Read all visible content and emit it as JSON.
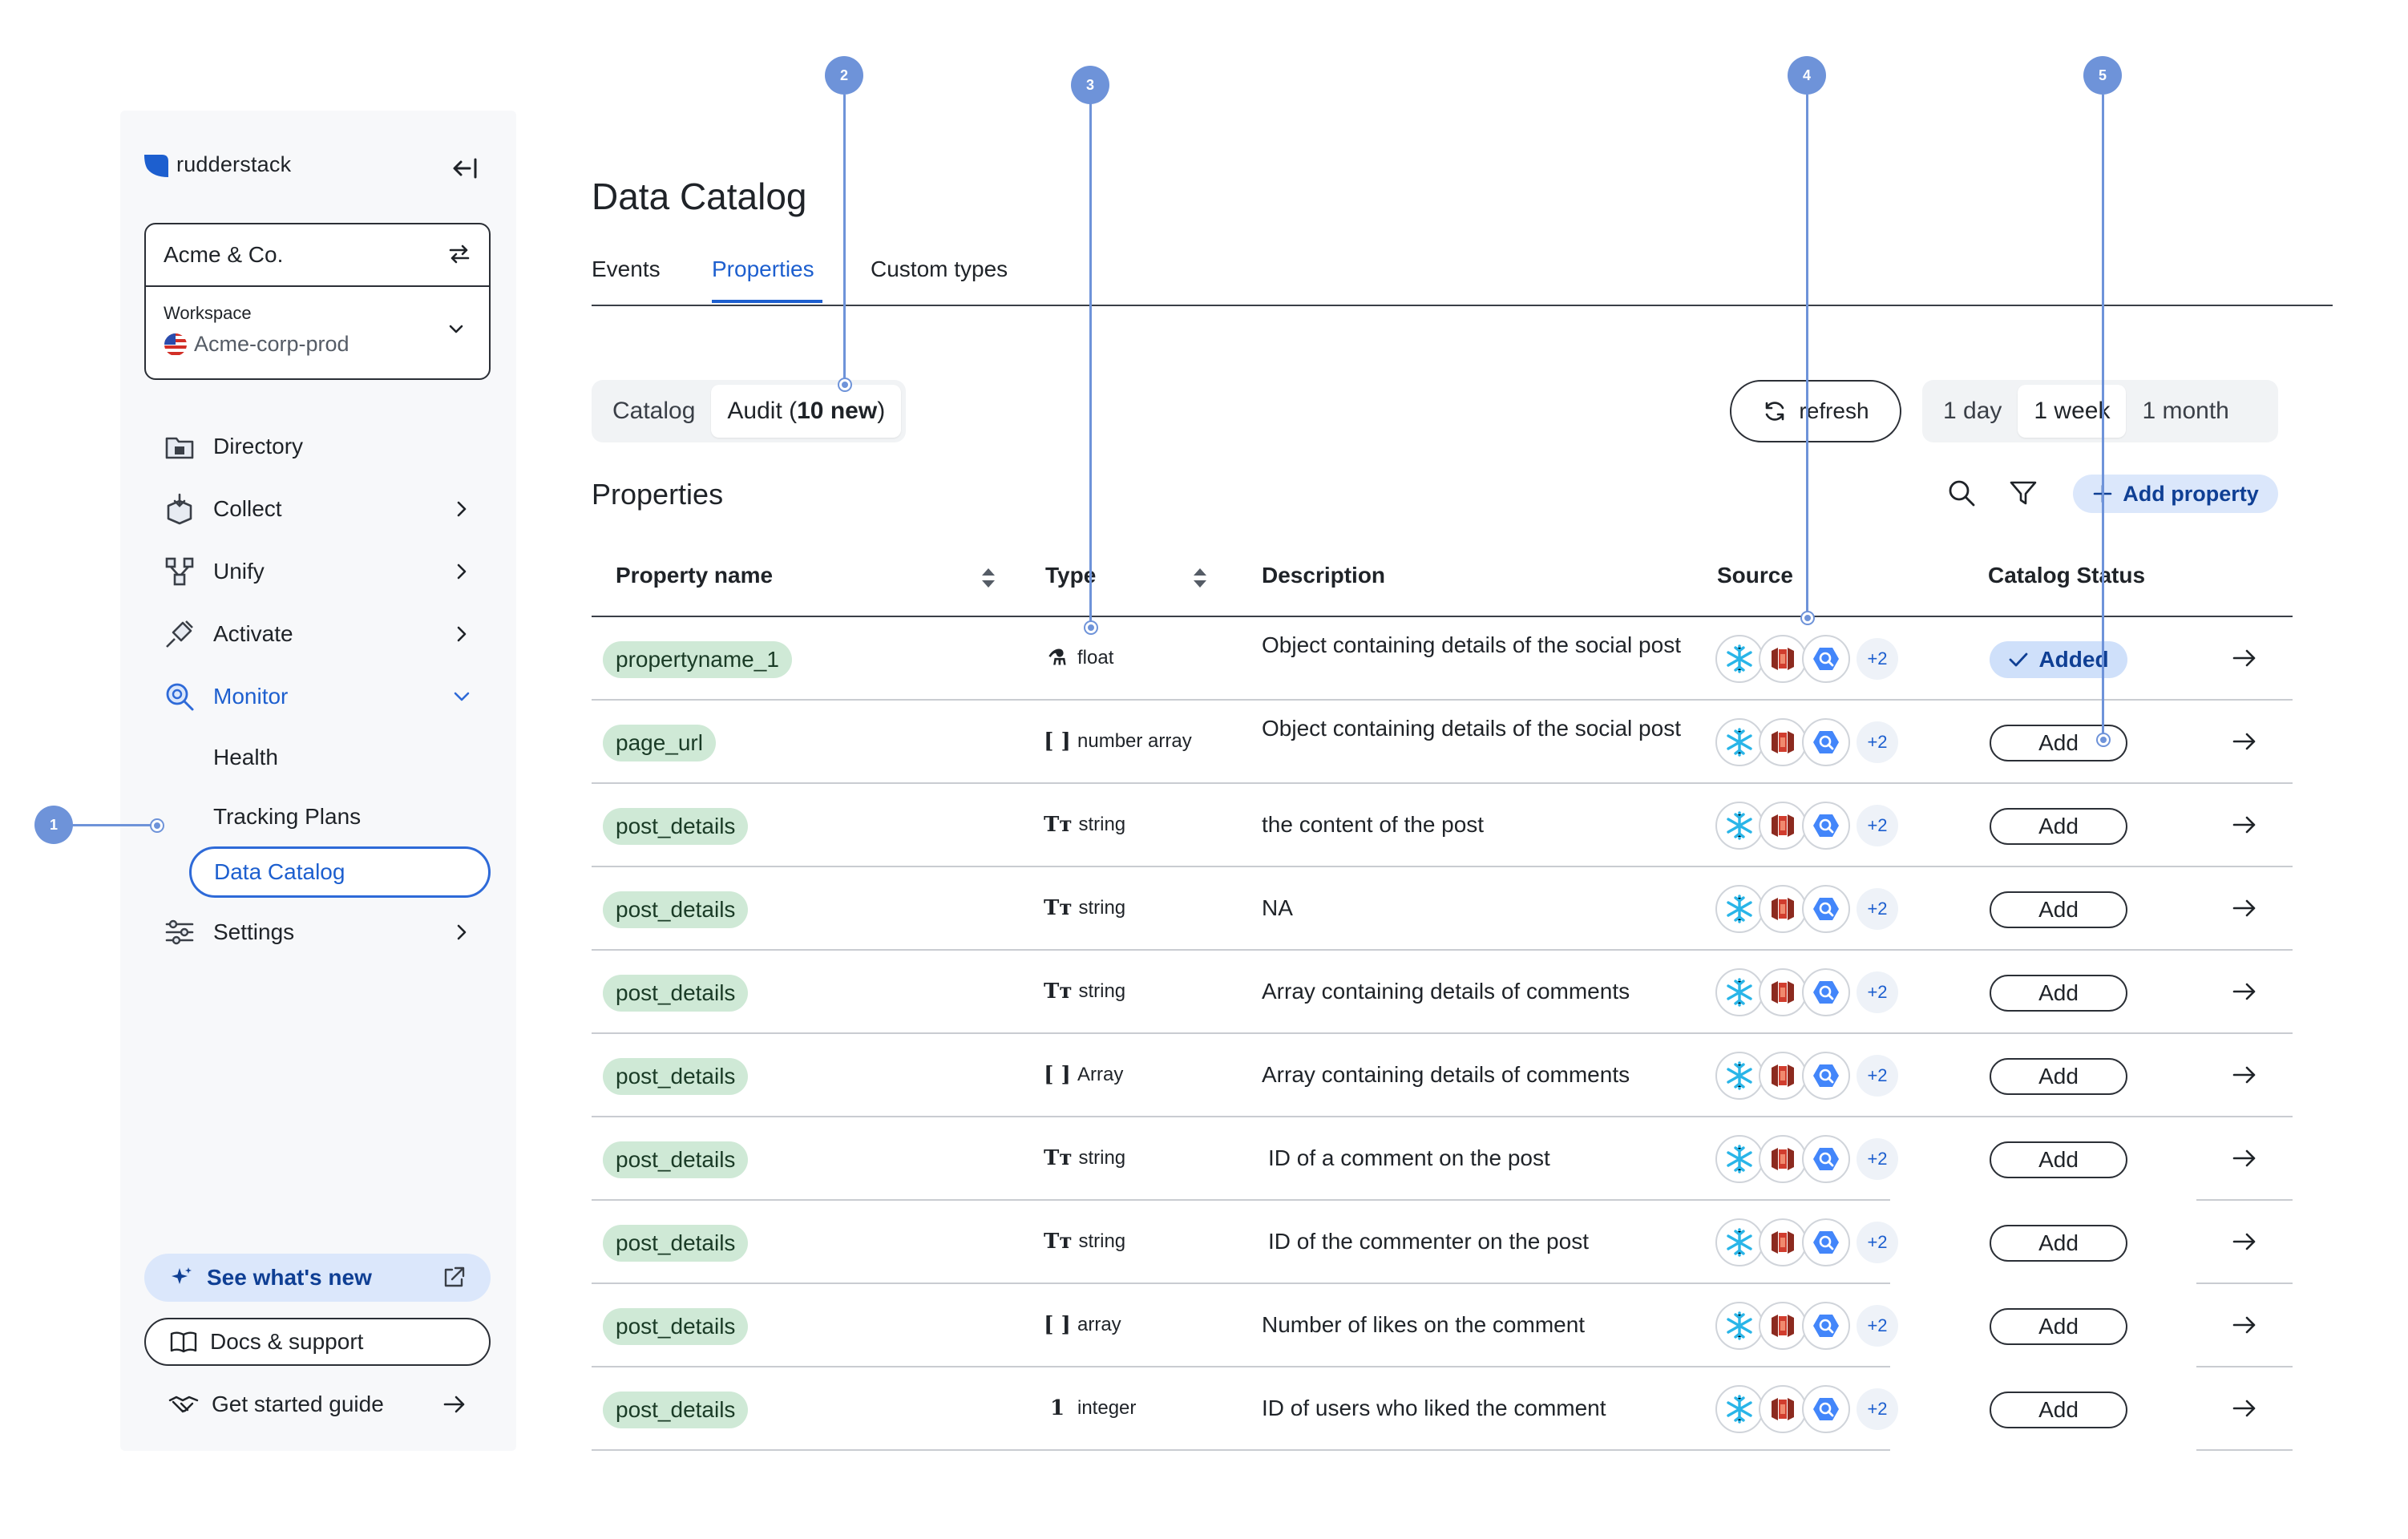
{
  "sidebar": {
    "logo_text": "rudderstack",
    "workspace": {
      "org": "Acme & Co.",
      "label": "Workspace",
      "name": "Acme-corp-prod"
    },
    "nav": [
      {
        "label": "Directory",
        "icon": "directory-icon"
      },
      {
        "label": "Collect",
        "icon": "collect-icon"
      },
      {
        "label": "Unify",
        "icon": "unify-icon"
      },
      {
        "label": "Activate",
        "icon": "activate-icon"
      },
      {
        "label": "Monitor",
        "icon": "monitor-icon"
      }
    ],
    "monitor_sub": [
      "Health",
      "Tracking Plans",
      "Data Catalog"
    ],
    "settings_label": "Settings",
    "bottom": {
      "whats_new": "See what's new",
      "docs": "Docs & support",
      "guide": "Get started guide"
    }
  },
  "main": {
    "title": "Data Catalog",
    "tabs": [
      "Events",
      "Properties",
      "Custom types"
    ],
    "active_tab": "Properties",
    "view_toggle": {
      "catalog": "Catalog",
      "audit_prefix": "Audit (",
      "audit_count": "10 new",
      "audit_suffix": ")"
    },
    "refresh_label": "refresh",
    "time_range": [
      "1 day",
      "1 week",
      "1 month"
    ],
    "selected_range": "1 week",
    "section_title": "Properties",
    "add_property_label": "Add property",
    "columns": [
      "Property name",
      "Type",
      "Description",
      "Source",
      "Catalog Status"
    ],
    "rows": [
      {
        "name": "propertyname_1",
        "type_glyph": "⚗",
        "type": "float",
        "description": "Object containing details of the social post",
        "more_sources": "+2",
        "status": "Added"
      },
      {
        "name": "page_url",
        "type_glyph": "[ ]",
        "type": "number array",
        "description": "Object containing details of the social post",
        "more_sources": "+2",
        "status": "Add"
      },
      {
        "name": "post_details",
        "type_glyph": "Tт",
        "type": "string",
        "description": "the content of the post",
        "more_sources": "+2",
        "status": "Add"
      },
      {
        "name": "post_details",
        "type_glyph": "Tт",
        "type": "string",
        "description": "NA",
        "more_sources": "+2",
        "status": "Add"
      },
      {
        "name": "post_details",
        "type_glyph": "Tт",
        "type": "string",
        "description": "Array containing details of comments",
        "more_sources": "+2",
        "status": "Add"
      },
      {
        "name": "post_details",
        "type_glyph": "[ ]",
        "type": "Array",
        "description": "Array containing details of comments",
        "more_sources": "+2",
        "status": "Add"
      },
      {
        "name": "post_details",
        "type_glyph": "Tт",
        "type": "string",
        "description": " ID of a comment on the post",
        "more_sources": "+2",
        "status": "Add"
      },
      {
        "name": "post_details",
        "type_glyph": "Tт",
        "type": "string",
        "description": " ID of the commenter on the post",
        "more_sources": "+2",
        "status": "Add"
      },
      {
        "name": "post_details",
        "type_glyph": "[ ]",
        "type": "array",
        "description": "Number of likes on the comment",
        "more_sources": "+2",
        "status": "Add"
      },
      {
        "name": "post_details",
        "type_glyph": "1",
        "type": "integer",
        "description": "ID of users who liked the comment",
        "more_sources": "+2",
        "status": "Add"
      }
    ]
  },
  "annotations": [
    "1",
    "2",
    "3",
    "4",
    "5"
  ],
  "colors": {
    "accent": "#1d5fcf",
    "pill_bg": "#cfe9d6",
    "annotation": "#6e93d9",
    "sidebar_bg": "#f7f8fa"
  }
}
